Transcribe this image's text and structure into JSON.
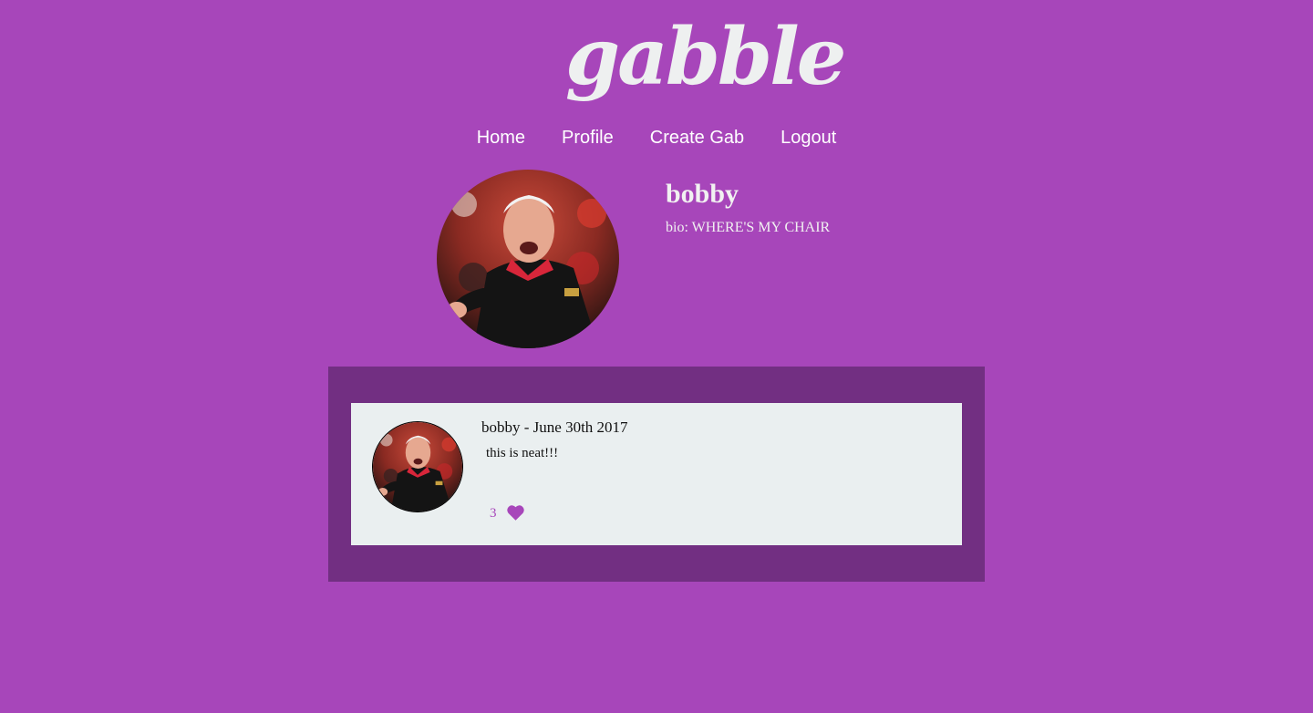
{
  "logo": {
    "text": "gabble"
  },
  "nav": {
    "home": "Home",
    "profile": "Profile",
    "create_gab": "Create Gab",
    "logout": "Logout"
  },
  "profile": {
    "username": "bobby",
    "bio": "bio: WHERE'S MY CHAIR",
    "avatar_icon": "coach-avatar"
  },
  "gabs": [
    {
      "author": "bobby",
      "date": "June 30th 2017",
      "header": "bobby - June 30th 2017",
      "text": "this is neat!!!",
      "likes": "3",
      "like_icon": "heart-icon"
    }
  ],
  "colors": {
    "background": "#a746ba",
    "feed_background": "#722f82",
    "card_background": "#eaeff0",
    "accent": "#a746ba"
  }
}
